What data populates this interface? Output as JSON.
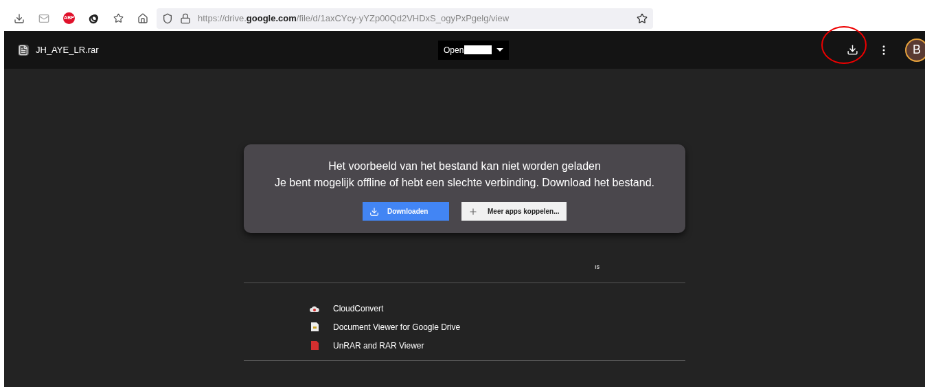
{
  "browser": {
    "url": "https://drive.**google.com**/file/d/1axCYcy-yYZp00Qd2VHDxS_ogyPxPgelg/view",
    "extension_badge": "ABP"
  },
  "header": {
    "file_name": "JH_AYE_LR.rar",
    "open_with": "Open",
    "avatar": "B"
  },
  "error_card": {
    "title": "Het voorbeeld van het bestand kan niet worden geladen",
    "message": "Je bent mogelijk offline of hebt een slechte verbinding. Download het bestand.",
    "buttons": [
      {
        "kind": "primary",
        "label": "Downloaden"
      },
      {
        "kind": "secondary",
        "label": "Meer apps koppelen..."
      }
    ]
  },
  "fragment": "ıs",
  "apps": [
    {
      "kind": "cloud",
      "name": "CloudConvert"
    },
    {
      "kind": "doc",
      "name": "Document Viewer for Google Drive"
    },
    {
      "kind": "rar",
      "name": "UnRAR and RAR Viewer"
    }
  ]
}
